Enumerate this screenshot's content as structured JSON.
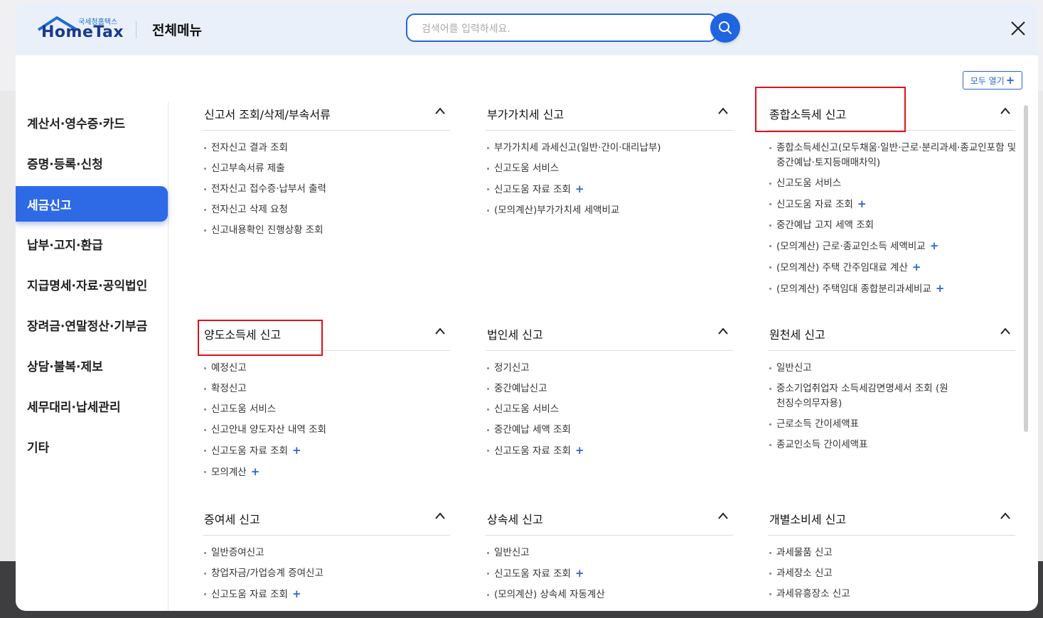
{
  "header": {
    "logo_small": "국세청홈택스",
    "logo_text": "HomeTax",
    "title": "전체메뉴",
    "search_placeholder": "검색어를 입력하세요."
  },
  "expand_all_label": "모두 열기",
  "sidebar": {
    "items": [
      {
        "label": "계산서·영수증·카드",
        "active": false
      },
      {
        "label": "증명·등록·신청",
        "active": false
      },
      {
        "label": "세금신고",
        "active": true
      },
      {
        "label": "납부·고지·환급",
        "active": false
      },
      {
        "label": "지급명세·자료·공익법인",
        "active": false
      },
      {
        "label": "장려금·연말정산·기부금",
        "active": false
      },
      {
        "label": "상담·불복·제보",
        "active": false
      },
      {
        "label": "세무대리·납세관리",
        "active": false
      },
      {
        "label": "기타",
        "active": false
      }
    ]
  },
  "sections": [
    {
      "title": "신고서 조회/삭제/부속서류",
      "items": [
        {
          "label": "전자신고 결과 조회",
          "plus": false
        },
        {
          "label": "신고부속서류 제출",
          "plus": false
        },
        {
          "label": "전자신고 접수증·납부서 출력",
          "plus": false
        },
        {
          "label": "전자신고 삭제 요청",
          "plus": false
        },
        {
          "label": "신고내용확인 진행상황 조회",
          "plus": false
        }
      ]
    },
    {
      "title": "부가가치세 신고",
      "items": [
        {
          "label": "부가가치세 과세신고(일반·간이·대리납부)",
          "plus": false
        },
        {
          "label": "신고도움 서비스",
          "plus": false
        },
        {
          "label": "신고도움 자료 조회",
          "plus": true
        },
        {
          "label": "(모의계산)부가가치세 세액비교",
          "plus": false
        }
      ]
    },
    {
      "title": "종합소득세 신고",
      "items": [
        {
          "label": "종합소득세신고(모두채움·일반·근로·분리과세·종교인포함 및 중간예납·토지등매매차익)",
          "plus": false,
          "wrap": true
        },
        {
          "label": "신고도움 서비스",
          "plus": false
        },
        {
          "label": "신고도움 자료 조회",
          "plus": true
        },
        {
          "label": "중간예납 고지 세액 조회",
          "plus": false
        },
        {
          "label": "(모의계산) 근로·종교인소득 세액비교",
          "plus": true
        },
        {
          "label": "(모의계산) 주택 간주임대료 계산",
          "plus": true
        },
        {
          "label": "(모의계산) 주택임대 종합분리과세비교",
          "plus": true
        }
      ]
    },
    {
      "title": "양도소득세 신고",
      "items": [
        {
          "label": "예정신고",
          "plus": false
        },
        {
          "label": "확정신고",
          "plus": false
        },
        {
          "label": "신고도움 서비스",
          "plus": false
        },
        {
          "label": "신고안내 양도자산 내역 조회",
          "plus": false
        },
        {
          "label": "신고도움 자료 조회",
          "plus": true
        },
        {
          "label": "모의계산",
          "plus": true
        }
      ]
    },
    {
      "title": "법인세 신고",
      "items": [
        {
          "label": "정기신고",
          "plus": false
        },
        {
          "label": "중간예납신고",
          "plus": false
        },
        {
          "label": "신고도움 서비스",
          "plus": false
        },
        {
          "label": "중간예납 세액 조회",
          "plus": false
        },
        {
          "label": "신고도움 자료 조회",
          "plus": true
        }
      ]
    },
    {
      "title": "원천세 신고",
      "items": [
        {
          "label": "일반신고",
          "plus": false
        },
        {
          "label": "중소기업취업자 소득세감면명세서 조회 (원천징수의무자용)",
          "plus": false,
          "wrap": true
        },
        {
          "label": "근로소득 간이세액표",
          "plus": false
        },
        {
          "label": "종교인소득 간이세액표",
          "plus": false
        }
      ]
    },
    {
      "title": "증여세 신고",
      "items": [
        {
          "label": "일반증여신고",
          "plus": false
        },
        {
          "label": "창업자금/가업승계 증여신고",
          "plus": false
        },
        {
          "label": "신고도움 자료 조회",
          "plus": true
        }
      ]
    },
    {
      "title": "상속세 신고",
      "items": [
        {
          "label": "일반신고",
          "plus": false
        },
        {
          "label": "신고도움 자료 조회",
          "plus": true
        },
        {
          "label": "(모의계산) 상속세 자동계산",
          "plus": false
        }
      ]
    },
    {
      "title": "개별소비세 신고",
      "items": [
        {
          "label": "과세물품 신고",
          "plus": false
        },
        {
          "label": "과세장소 신고",
          "plus": false
        },
        {
          "label": "과세유흥장소 신고",
          "plus": false
        }
      ]
    }
  ]
}
